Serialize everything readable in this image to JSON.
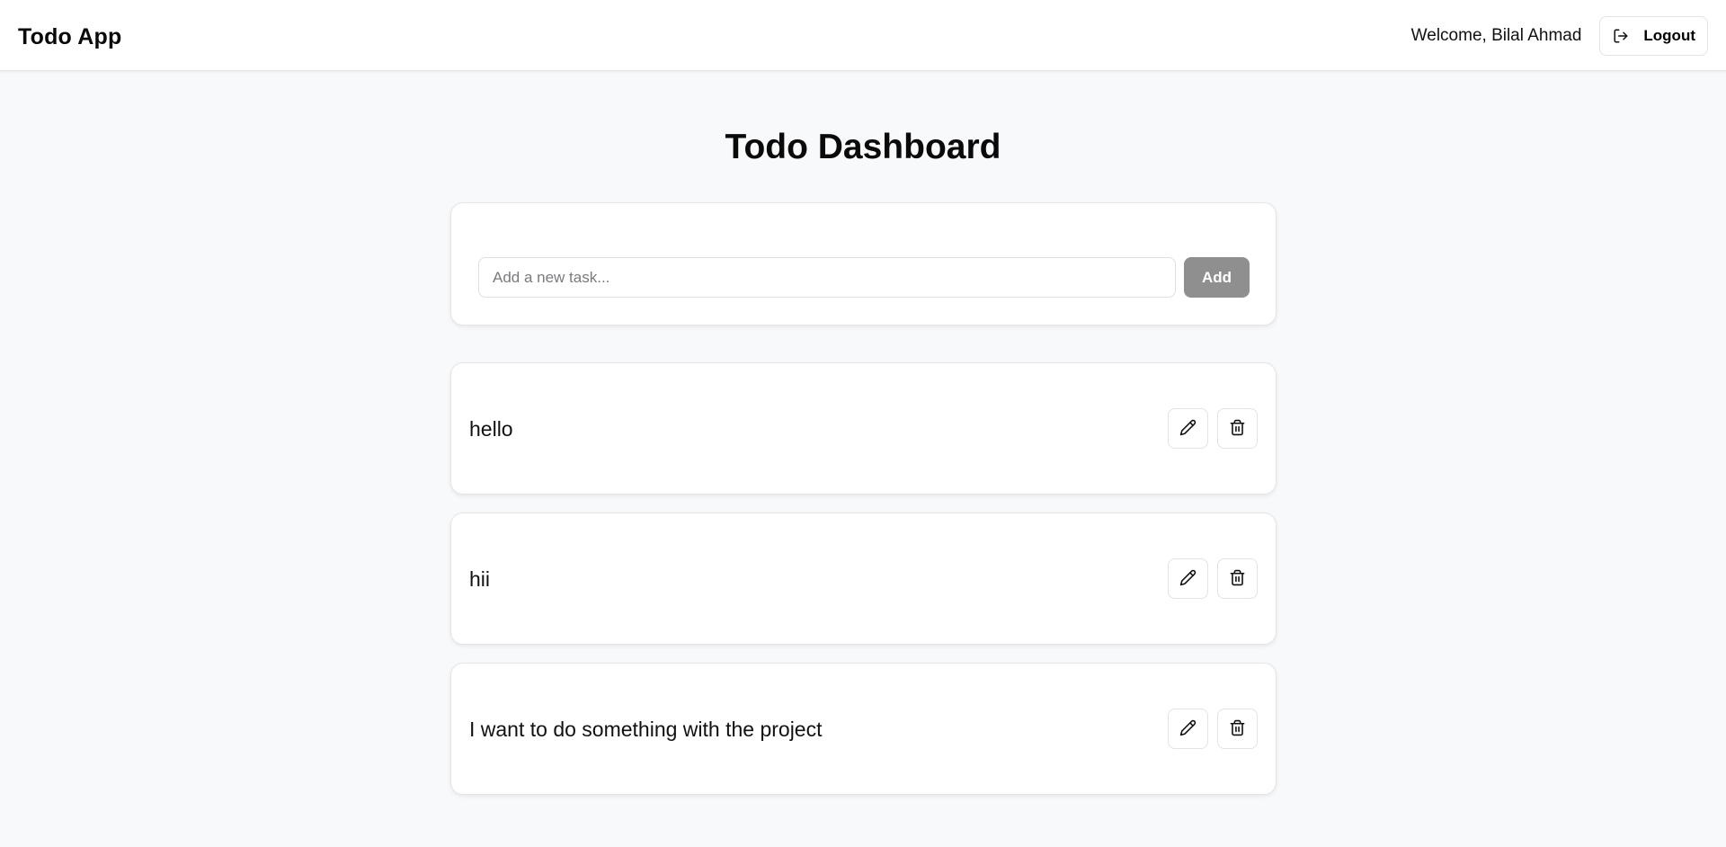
{
  "navbar": {
    "brand": "Todo App",
    "welcome": "Welcome, Bilal Ahmad",
    "logout_label": "Logout",
    "logout_icon": "log-out-icon"
  },
  "main": {
    "title": "Todo Dashboard",
    "add_form": {
      "placeholder": "Add a new task...",
      "value": "",
      "add_label": "Add",
      "add_color": "#8f8f8f"
    },
    "todos": [
      {
        "text": "hello",
        "edit_icon": "pencil-icon",
        "delete_icon": "trash-icon"
      },
      {
        "text": "hii",
        "edit_icon": "pencil-icon",
        "delete_icon": "trash-icon"
      },
      {
        "text": "I want to do something with the project",
        "edit_icon": "pencil-icon",
        "delete_icon": "trash-icon"
      }
    ]
  },
  "colors": {
    "background": "#f8f9fb",
    "card": "#ffffff",
    "border": "#e4e5e9",
    "text": "#0a0a0a"
  }
}
